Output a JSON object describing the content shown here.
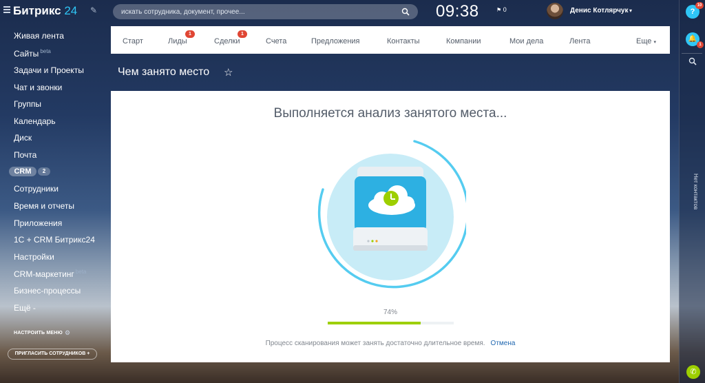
{
  "sidebar": {
    "logo_main": "Битрикс",
    "logo_suffix": "24",
    "items": [
      {
        "label": "Живая лента"
      },
      {
        "label": "Сайты",
        "badge": "beta"
      },
      {
        "label": "Задачи и Проекты"
      },
      {
        "label": "Чат и звонки"
      },
      {
        "label": "Группы"
      },
      {
        "label": "Календарь"
      },
      {
        "label": "Диск"
      },
      {
        "label": "Почта"
      },
      {
        "label": "CRM",
        "count": "2"
      },
      {
        "label": "Сотрудники"
      },
      {
        "label": "Время и отчеты"
      },
      {
        "label": "Приложения"
      },
      {
        "label": "1С + CRM Битрикс24"
      },
      {
        "label": "Настройки"
      },
      {
        "label": "CRM-маркетинг",
        "badge": "beta"
      },
      {
        "label": "Бизнес-процессы"
      },
      {
        "label": "Ещё -"
      }
    ],
    "configure_menu": "НАСТРОИТЬ МЕНЮ",
    "invite": "ПРИГЛАСИТЬ СОТРУДНИКОВ",
    "invite_plus": "+"
  },
  "header": {
    "search_placeholder": "искать сотрудника, документ, прочее...",
    "clock": "09:38",
    "flag_count": "0",
    "user_name": "Денис Котлярчук"
  },
  "right_panel": {
    "help_badge": "10",
    "bell_badge": "1",
    "no_contacts": "Нет контактов"
  },
  "nav": {
    "items": [
      {
        "label": "Старт"
      },
      {
        "label": "Лиды",
        "badge": "1"
      },
      {
        "label": "Сделки",
        "badge": "1"
      },
      {
        "label": "Счета"
      },
      {
        "label": "Предложения"
      },
      {
        "label": "Контакты"
      },
      {
        "label": "Компании"
      },
      {
        "label": "Мои дела"
      },
      {
        "label": "Лента"
      },
      {
        "label": "Еще"
      }
    ]
  },
  "page": {
    "title": "Чем занято место",
    "analysis_title": "Выполняется анализ занятого места...",
    "progress": 74,
    "progress_text": "74%",
    "scan_note": "Процесс сканирования может занять достаточно длительное время.",
    "cancel": "Отмена"
  },
  "colors": {
    "accent": "#2fc6f6",
    "progress": "#9dcf00",
    "badge": "#e04634",
    "link": "#2067b0"
  }
}
